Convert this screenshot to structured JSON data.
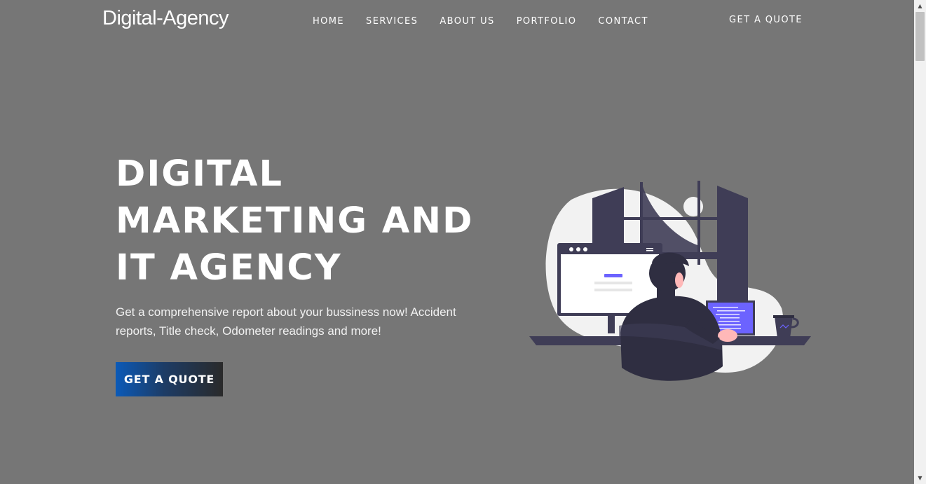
{
  "brand": {
    "name": "Digital-Agency"
  },
  "nav": {
    "items": [
      {
        "label": "HOME"
      },
      {
        "label": "SERVICES"
      },
      {
        "label": "ABOUT US"
      },
      {
        "label": "PORTFOLIO"
      },
      {
        "label": "CONTACT"
      }
    ],
    "quote_label": "GET A QUOTE"
  },
  "hero": {
    "title_lines": [
      "DIGITAL",
      "MARKETING AND",
      "IT AGENCY"
    ],
    "description": "Get a comprehensive report about your bussiness now! Accident reports, Title check, Odometer readings and more!",
    "cta_label": "GET A QUOTE"
  },
  "colors": {
    "background": "#767676",
    "accent": "#6c63ff",
    "cta_gradient_start": "#0b5ab8",
    "cta_gradient_end": "#2a2a2a",
    "illustration_dark": "#3f3d56"
  },
  "icons": {
    "scroll_up": "triangle-up-icon",
    "scroll_down": "triangle-down-icon"
  }
}
